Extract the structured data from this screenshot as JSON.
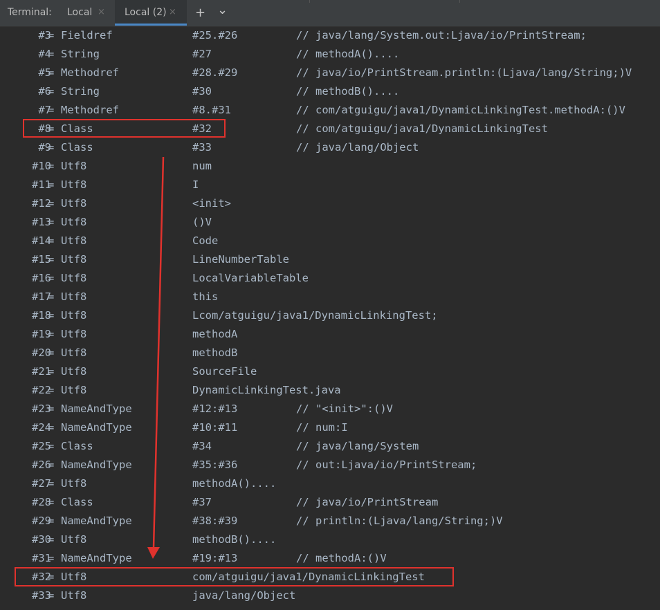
{
  "header": {
    "label": "Terminal:",
    "tabs": [
      {
        "label": "Local",
        "close": "×"
      },
      {
        "label": "Local (2)",
        "close": "×"
      }
    ],
    "add_icon": "+",
    "menu_icon": "⌄"
  },
  "constant_pool": [
    {
      "index": "#3",
      "type": "Fieldref",
      "value": "#25.#26",
      "comment": "// java/lang/System.out:Ljava/io/PrintStream;"
    },
    {
      "index": "#4",
      "type": "String",
      "value": "#27",
      "comment": "// methodA()...."
    },
    {
      "index": "#5",
      "type": "Methodref",
      "value": "#28.#29",
      "comment": "// java/io/PrintStream.println:(Ljava/lang/String;)V"
    },
    {
      "index": "#6",
      "type": "String",
      "value": "#30",
      "comment": "// methodB()...."
    },
    {
      "index": "#7",
      "type": "Methodref",
      "value": "#8.#31",
      "comment": "// com/atguigu/java1/DynamicLinkingTest.methodA:()V"
    },
    {
      "index": "#8",
      "type": "Class",
      "value": "#32",
      "comment": "// com/atguigu/java1/DynamicLinkingTest"
    },
    {
      "index": "#9",
      "type": "Class",
      "value": "#33",
      "comment": "// java/lang/Object"
    },
    {
      "index": "#10",
      "type": "Utf8",
      "value": "num",
      "comment": ""
    },
    {
      "index": "#11",
      "type": "Utf8",
      "value": "I",
      "comment": ""
    },
    {
      "index": "#12",
      "type": "Utf8",
      "value": "<init>",
      "comment": ""
    },
    {
      "index": "#13",
      "type": "Utf8",
      "value": "()V",
      "comment": ""
    },
    {
      "index": "#14",
      "type": "Utf8",
      "value": "Code",
      "comment": ""
    },
    {
      "index": "#15",
      "type": "Utf8",
      "value": "LineNumberTable",
      "comment": ""
    },
    {
      "index": "#16",
      "type": "Utf8",
      "value": "LocalVariableTable",
      "comment": ""
    },
    {
      "index": "#17",
      "type": "Utf8",
      "value": "this",
      "comment": ""
    },
    {
      "index": "#18",
      "type": "Utf8",
      "value": "Lcom/atguigu/java1/DynamicLinkingTest;",
      "comment": ""
    },
    {
      "index": "#19",
      "type": "Utf8",
      "value": "methodA",
      "comment": ""
    },
    {
      "index": "#20",
      "type": "Utf8",
      "value": "methodB",
      "comment": ""
    },
    {
      "index": "#21",
      "type": "Utf8",
      "value": "SourceFile",
      "comment": ""
    },
    {
      "index": "#22",
      "type": "Utf8",
      "value": "DynamicLinkingTest.java",
      "comment": ""
    },
    {
      "index": "#23",
      "type": "NameAndType",
      "value": "#12:#13",
      "comment": "// \"<init>\":()V"
    },
    {
      "index": "#24",
      "type": "NameAndType",
      "value": "#10:#11",
      "comment": "// num:I"
    },
    {
      "index": "#25",
      "type": "Class",
      "value": "#34",
      "comment": "// java/lang/System"
    },
    {
      "index": "#26",
      "type": "NameAndType",
      "value": "#35:#36",
      "comment": "// out:Ljava/io/PrintStream;"
    },
    {
      "index": "#27",
      "type": "Utf8",
      "value": "methodA()....",
      "comment": ""
    },
    {
      "index": "#28",
      "type": "Class",
      "value": "#37",
      "comment": "// java/io/PrintStream"
    },
    {
      "index": "#29",
      "type": "NameAndType",
      "value": "#38:#39",
      "comment": "// println:(Ljava/lang/String;)V"
    },
    {
      "index": "#30",
      "type": "Utf8",
      "value": "methodB()....",
      "comment": ""
    },
    {
      "index": "#31",
      "type": "NameAndType",
      "value": "#19:#13",
      "comment": "// methodA:()V"
    },
    {
      "index": "#32",
      "type": "Utf8",
      "value": "com/atguigu/java1/DynamicLinkingTest",
      "comment": ""
    },
    {
      "index": "#33",
      "type": "Utf8",
      "value": "java/lang/Object",
      "comment": ""
    }
  ],
  "colors": {
    "background": "#2b2b2b",
    "text": "#a9b7c6",
    "highlight": "#e0322d",
    "active_tab_underline": "#4a88c7"
  }
}
